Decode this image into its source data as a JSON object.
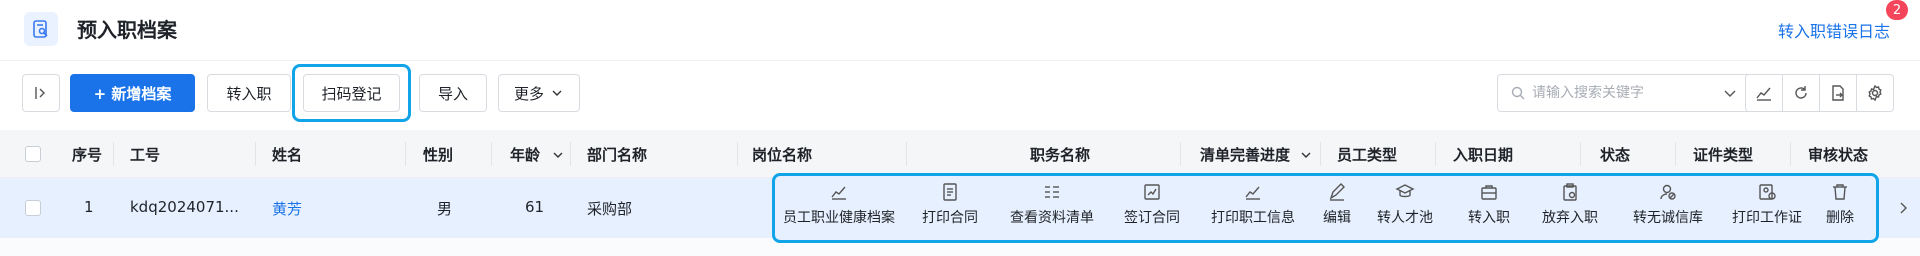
{
  "header": {
    "title": "预入职档案",
    "error_log_link": "转入职错误日志",
    "error_badge_count": "2"
  },
  "toolbar": {
    "add_button": "+ 新增档案",
    "transfer_button": "转入职",
    "scan_button": "扫码登记",
    "import_button": "导入",
    "more_button": "更多",
    "search_placeholder": "请输入搜索关键字"
  },
  "table": {
    "columns": [
      "序号",
      "工号",
      "姓名",
      "性别",
      "年龄",
      "部门名称",
      "岗位名称",
      "职务名称",
      "清单完善进度",
      "员工类型",
      "入职日期",
      "状态",
      "证件类型",
      "审核状态"
    ],
    "rows": [
      {
        "index": "1",
        "employee_id": "kdq2024071...",
        "name": "黄芳",
        "gender": "男",
        "age": "61",
        "department": "采购部"
      }
    ]
  },
  "row_actions": [
    {
      "label": "员工职业健康档案",
      "icon": "chart-icon"
    },
    {
      "label": "打印合同",
      "icon": "document-icon"
    },
    {
      "label": "查看资料清单",
      "icon": "checklist-icon"
    },
    {
      "label": "签订合同",
      "icon": "sign-icon"
    },
    {
      "label": "打印职工信息",
      "icon": "chart-icon"
    },
    {
      "label": "编辑",
      "icon": "pen-icon"
    },
    {
      "label": "转人才池",
      "icon": "graduation-cap-icon"
    },
    {
      "label": "转入职",
      "icon": "briefcase-icon"
    },
    {
      "label": "放弃入职",
      "icon": "clipboard-icon"
    },
    {
      "label": "转无诚信库",
      "icon": "user-block-icon"
    },
    {
      "label": "打印工作证",
      "icon": "badge-icon"
    },
    {
      "label": "删除",
      "icon": "trash-icon"
    }
  ],
  "colors": {
    "primary": "#1a73e8",
    "highlight_ring": "#12a4e8",
    "row_selected": "#e7f0ff",
    "badge": "#f5455b"
  }
}
